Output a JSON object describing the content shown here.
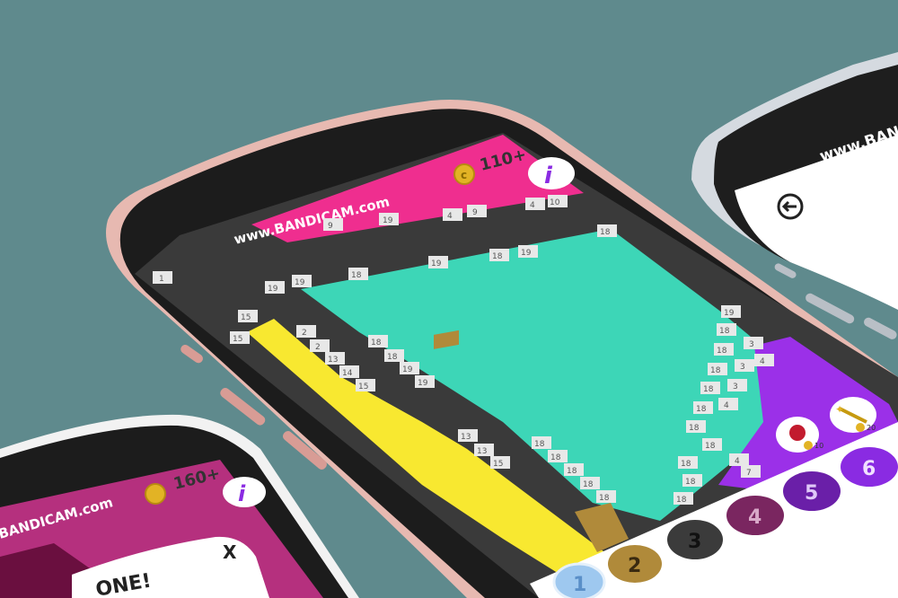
{
  "main_phone": {
    "watermark": "www.BANDICAM.com",
    "coins": "110+",
    "hint_icon": "letter-i-icon",
    "bomb_cost": "10",
    "wand_cost": "20",
    "palette": [
      "1",
      "2",
      "3",
      "4",
      "5",
      "6"
    ],
    "palette_colors": [
      "#9ec8ef",
      "#b08a3a",
      "#3b3b3b",
      "#7a2660",
      "#6a1fa8",
      "#8a2be2"
    ],
    "grid_numbers": {
      "top": [
        "9",
        "19",
        "4",
        "9",
        "4",
        "10",
        "18"
      ],
      "mid": [
        "19",
        "19",
        "18",
        "19",
        "18",
        "19"
      ],
      "left": [
        "1",
        "15",
        "15",
        "2",
        "2",
        "13",
        "14",
        "15"
      ],
      "center": [
        "18",
        "18",
        "19",
        "19",
        "13",
        "13",
        "15",
        "18",
        "18",
        "18",
        "18",
        "18"
      ],
      "right": [
        "19",
        "18",
        "18",
        "3",
        "4",
        "18",
        "3",
        "18",
        "3",
        "18",
        "4",
        "18",
        "18",
        "18",
        "18",
        "4",
        "18",
        "7"
      ]
    },
    "colors": {
      "teal": "#3dd6b7",
      "yellow": "#f8e830",
      "pink": "#ef2e8f",
      "purple": "#9b30e8",
      "dark": "#3a3a3a"
    }
  },
  "left_phone": {
    "watermark": "BANDICAM.com",
    "coins": "160+",
    "close_label": "X",
    "done_text": "ONE!"
  },
  "right_phone": {
    "watermark": "www.BANDICA"
  }
}
